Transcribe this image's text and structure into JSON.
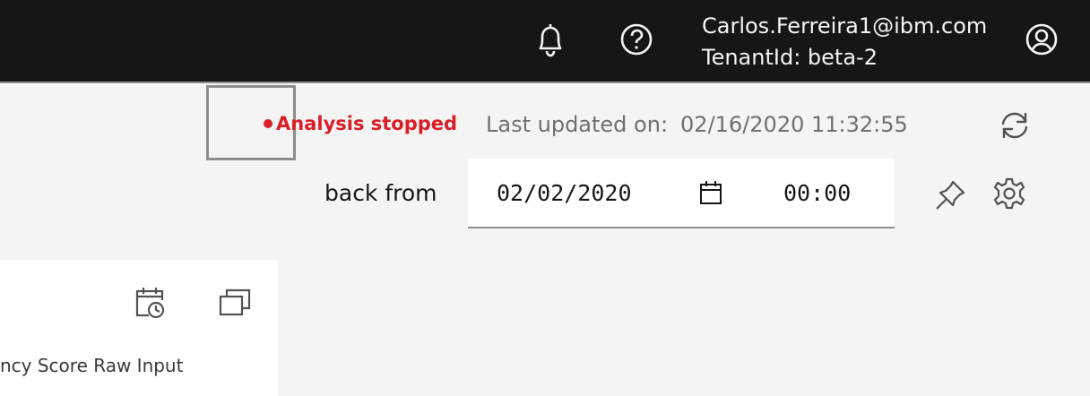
{
  "header": {
    "user_email": "Carlos.Ferreira1@ibm.com",
    "tenant": "TenantId: beta-2",
    "icons": [
      "bell-icon",
      "help-icon",
      "user-avatar-icon"
    ]
  },
  "status": {
    "text": "Analysis stopped",
    "color": "#da1e28"
  },
  "last_updated": {
    "label": "Last updated on:",
    "value": "02/16/2020 11:32:55"
  },
  "range": {
    "label": "back from",
    "date": "02/02/2020",
    "time": "00:00"
  },
  "card": {
    "label": "ncy Score Raw Input"
  }
}
